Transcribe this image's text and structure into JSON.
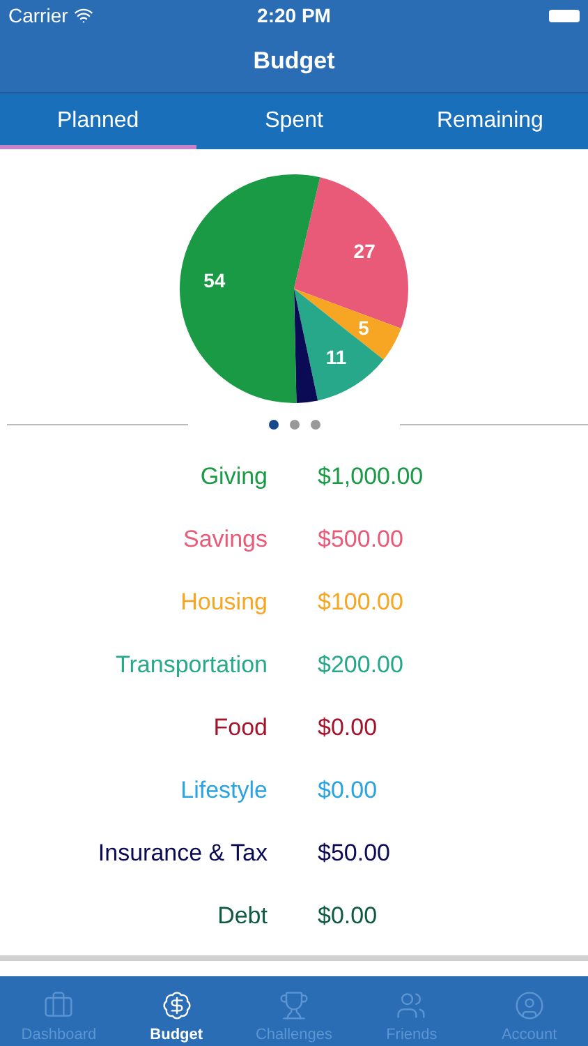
{
  "status_bar": {
    "carrier": "Carrier",
    "time": "2:20 PM"
  },
  "nav": {
    "title": "Budget"
  },
  "tabs": [
    {
      "label": "Planned",
      "selected": true
    },
    {
      "label": "Spent",
      "selected": false
    },
    {
      "label": "Remaining",
      "selected": false
    }
  ],
  "chart_data": {
    "type": "pie",
    "values": [
      27,
      5,
      11,
      3,
      54
    ],
    "colors": [
      "#e85a78",
      "#f6a623",
      "#27a88a",
      "#0b0b55",
      "#1a9a44"
    ],
    "value_labels": [
      "27",
      "5",
      "11",
      null,
      "54"
    ]
  },
  "pager": [
    {
      "selected": true
    },
    {
      "selected": false
    },
    {
      "selected": false
    }
  ],
  "categories": [
    {
      "name": "Giving",
      "amount": "$1,000.00",
      "color": "#1a9a44"
    },
    {
      "name": "Savings",
      "amount": "$500.00",
      "color": "#e85a78"
    },
    {
      "name": "Housing",
      "amount": "$100.00",
      "color": "#f6a623"
    },
    {
      "name": "Transportation",
      "amount": "$200.00",
      "color": "#27a88a"
    },
    {
      "name": "Food",
      "amount": "$0.00",
      "color": "#a3142a"
    },
    {
      "name": "Lifestyle",
      "amount": "$0.00",
      "color": "#2ba3e0"
    },
    {
      "name": "Insurance & Tax",
      "amount": "$50.00",
      "color": "#0b0b55"
    },
    {
      "name": "Debt",
      "amount": "$0.00",
      "color": "#0e5a40"
    }
  ],
  "tab_bar": [
    {
      "label": "Dashboard",
      "selected": false
    },
    {
      "label": "Budget",
      "selected": true
    },
    {
      "label": "Challenges",
      "selected": false
    },
    {
      "label": "Friends",
      "selected": false
    },
    {
      "label": "Account",
      "selected": false
    }
  ]
}
